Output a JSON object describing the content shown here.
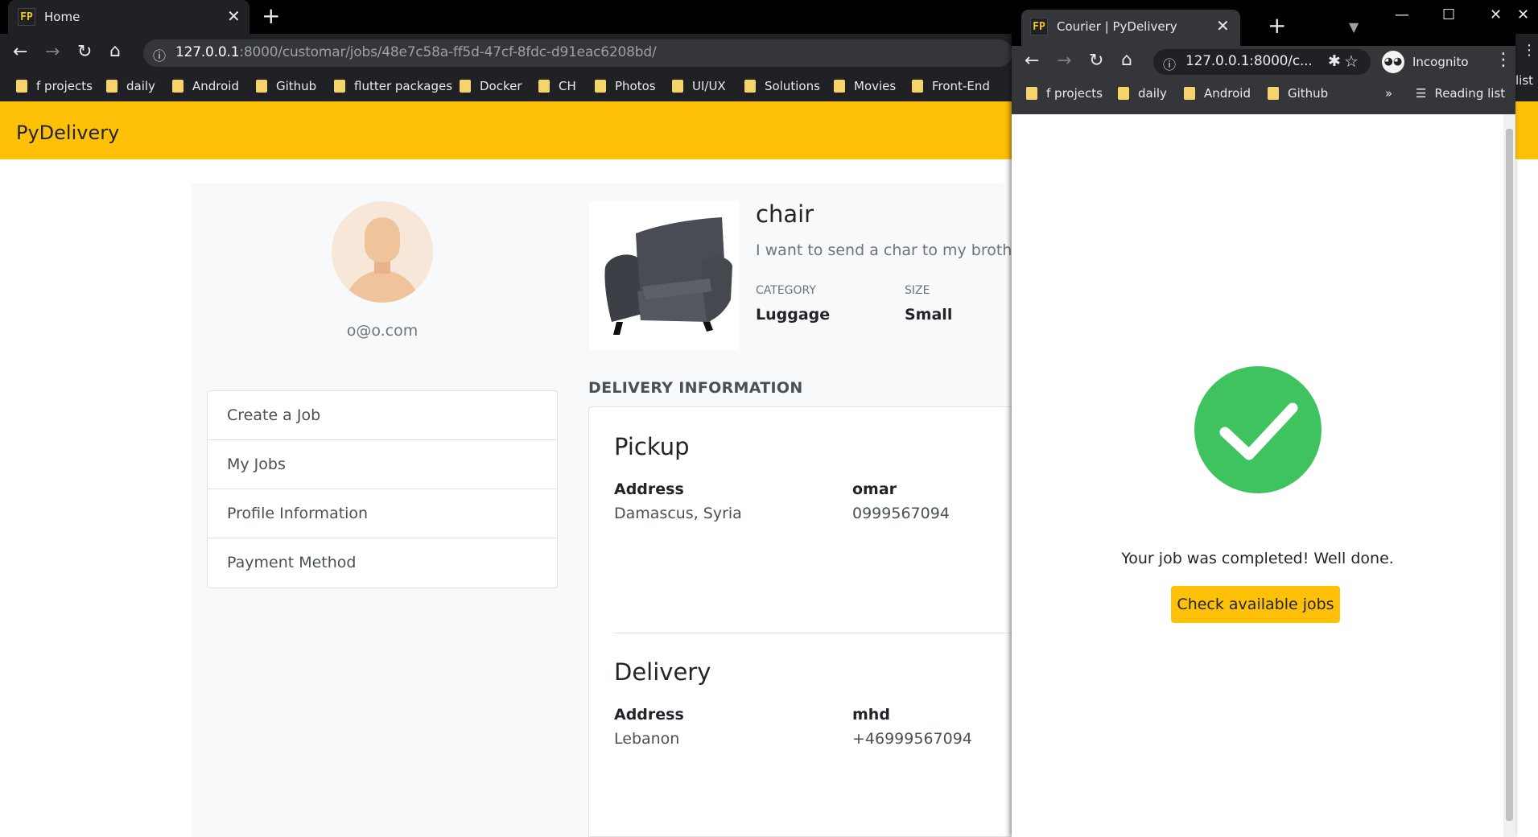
{
  "back_window": {
    "tab": {
      "favicon": "FP",
      "title": "Home"
    },
    "url": {
      "host": "127.0.0.1",
      "rest": ":8000/customar/jobs/48e7c58a-ff5d-47cf-8fdc-d91eac6208bd/"
    },
    "bookmarks": [
      "f projects",
      "daily",
      "Android",
      "Github",
      "flutter packages",
      "Docker",
      "CH",
      "Photos",
      "UI/UX",
      "Solutions",
      "Movies",
      "Front-End"
    ],
    "right_fragment": "list"
  },
  "app": {
    "brand": "PyDelivery",
    "profile": {
      "email": "o@o.com"
    },
    "menu": [
      "Create a Job",
      "My Jobs",
      "Profile Information",
      "Payment Method"
    ],
    "job": {
      "name": "chair",
      "description": "I want to send a char to my brother",
      "category_label": "CATEGORY",
      "category": "Luggage",
      "size_label": "SIZE",
      "size": "Small"
    },
    "delivery_info_title": "DELIVERY INFORMATION",
    "pickup": {
      "heading": "Pickup",
      "address_label": "Address",
      "address": "Damascus, Syria",
      "contact_name": "omar",
      "contact_phone": "0999567094"
    },
    "delivery": {
      "heading": "Delivery",
      "address_label": "Address",
      "address": "Lebanon",
      "contact_name": "mhd",
      "contact_phone": "+46999567094"
    }
  },
  "front_window": {
    "tab": {
      "favicon": "FP",
      "title": "Courier | PyDelivery"
    },
    "url": "127.0.0.1:8000/c...",
    "profile_label": "Incognito",
    "bookmarks": [
      "f projects",
      "daily",
      "Android",
      "Github"
    ],
    "overflow": "»",
    "reading_list": "Reading list",
    "message": "Your job was completed! Well done.",
    "button_label": "Check available jobs"
  },
  "colors": {
    "brand": "#ffc107",
    "success": "#3fc35f"
  }
}
